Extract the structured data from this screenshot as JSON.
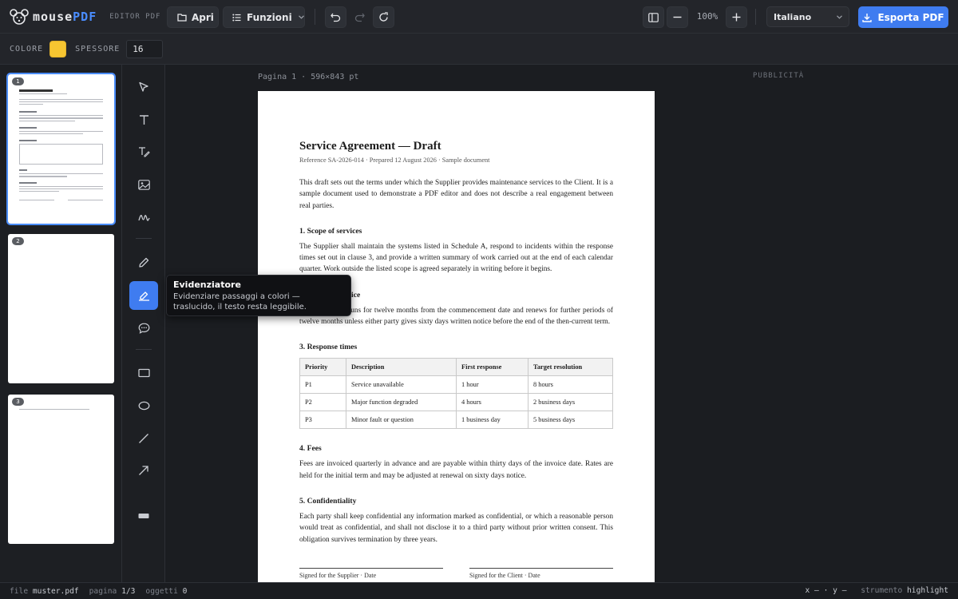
{
  "app": {
    "name_part1": "mouse",
    "name_part2": "PDF",
    "subtitle": "EDITOR PDF"
  },
  "toolbar": {
    "open_label": "Apri",
    "functions_label": "Funzioni",
    "zoom": "100%",
    "language": "Italiano",
    "export_label": "Esporta PDF"
  },
  "options": {
    "color_label": "COLORE",
    "color_value": "#f6c531",
    "thickness_label": "SPESSORE",
    "thickness_value": "16"
  },
  "thumbnails": [
    {
      "number": "1",
      "selected": true
    },
    {
      "number": "2",
      "selected": false
    },
    {
      "number": "3",
      "selected": false
    }
  ],
  "tools": [
    {
      "icon": "cursor-icon"
    },
    {
      "icon": "text-icon"
    },
    {
      "icon": "edit-text-icon"
    },
    {
      "icon": "image-icon"
    },
    {
      "icon": "signature-icon"
    },
    {
      "icon": "pencil-icon"
    },
    {
      "icon": "highlighter-icon",
      "active": true
    },
    {
      "icon": "comment-icon"
    },
    {
      "icon": "rectangle-icon"
    },
    {
      "icon": "ellipse-icon"
    },
    {
      "icon": "line-icon"
    },
    {
      "icon": "arrow-icon"
    },
    {
      "icon": "redact-icon"
    }
  ],
  "canvas": {
    "page_info": "Pagina 1 · 596×843 pt",
    "ad_label": "PUBBLICITÀ"
  },
  "document": {
    "title": "Service Agreement — Draft",
    "meta": "Reference SA-2026-014 · Prepared 12 August 2026 · Sample document",
    "intro": "This draft sets out the terms under which the Supplier provides maintenance services to the Client. It is a sample document used to demonstrate a PDF editor and does not describe a real engagement between real parties.",
    "s1_title": "1. Scope of services",
    "s1_text": "The Supplier shall maintain the systems listed in Schedule A, respond to incidents within the response times set out in clause 3, and provide a written summary of work carried out at the end of each calendar quarter. Work outside the listed scope is agreed separately in writing before it begins.",
    "s2_title": "2. Term and notice",
    "s2_text": "This agreement runs for twelve months from the commencement date and renews for further periods of twelve months unless either party gives sixty days written notice before the end of the then-current term.",
    "s3_title": "3. Response times",
    "table_headers": [
      "Priority",
      "Description",
      "First response",
      "Target resolution"
    ],
    "table_rows": [
      [
        "P1",
        "Service unavailable",
        "1 hour",
        "8 hours"
      ],
      [
        "P2",
        "Major function degraded",
        "4 hours",
        "2 business days"
      ],
      [
        "P3",
        "Minor fault or question",
        "1 business day",
        "5 business days"
      ]
    ],
    "s4_title": "4. Fees",
    "s4_text": "Fees are invoiced quarterly in advance and are payable within thirty days of the invoice date. Rates are held for the initial term and may be adjusted at renewal on sixty days notice.",
    "s5_title": "5. Confidentiality",
    "s5_text": "Each party shall keep confidential any information marked as confidential, or which a reasonable person would treat as confidential, and shall not disclose it to a third party without prior written consent. This obligation survives termination by three years.",
    "sig_supplier": "Signed for the Supplier · Date",
    "sig_client": "Signed for the Client · Date"
  },
  "tooltip": {
    "title": "Evidenziatore",
    "body": "Evidenziare passaggi a colori — traslucido, il testo resta leggibile."
  },
  "status": {
    "file_label": "file",
    "file_value": "muster.pdf",
    "page_label": "pagina",
    "page_value": "1/3",
    "objects_label": "oggetti",
    "objects_value": "0",
    "coords": "x – · y –",
    "tool_label": "strumento",
    "tool_value": "highlight"
  }
}
